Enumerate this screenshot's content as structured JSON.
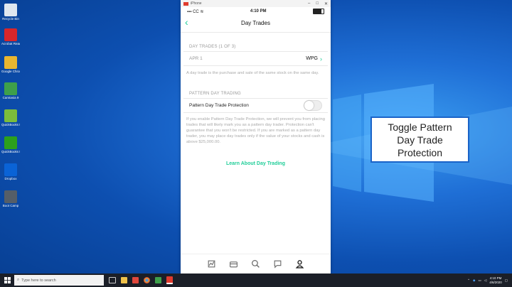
{
  "desktop": {
    "icons": [
      {
        "label": "Recycle Bin",
        "icon": "recycle-bin-icon",
        "color": "#dfe7ef"
      },
      {
        "label": "Acrobat Reader DC",
        "icon": "acrobat-icon",
        "color": "#d7262b"
      },
      {
        "label": "Google Chrome",
        "icon": "chrome-icon",
        "color": "#e9b630"
      },
      {
        "label": "Camtasia 9",
        "icon": "camtasia-icon",
        "color": "#3ea04b"
      },
      {
        "label": "QuickBooks File Manager",
        "icon": "quickbooks-file-icon",
        "color": "#7bbd3c"
      },
      {
        "label": "QuickBooks Premier",
        "icon": "quickbooks-icon",
        "color": "#2ca01c"
      },
      {
        "label": "Dropbox",
        "icon": "dropbox-icon",
        "color": "#0a63d6"
      },
      {
        "label": "Boot Camp",
        "icon": "drive-icon",
        "color": "#555e68"
      }
    ]
  },
  "window": {
    "title": "iPhone",
    "status": {
      "carrier": "CC",
      "time": "4:10 PM"
    },
    "nav": {
      "title": "Day Trades",
      "back_icon": "chevron-left-icon"
    },
    "day_trades": {
      "header": "DAY TRADES (1 OF 3)",
      "row_date": "APR 1",
      "row_symbol": "WPG",
      "definition": "A day trade is the purchase and sale of the same stock on the same day."
    },
    "pdt": {
      "header": "PATTERN DAY TRADING",
      "toggle_label": "Pattern Day Trade Protection",
      "toggle_on": false,
      "description": "If you enable Pattern Day Trade Protection, we will prevent you from placing trades that will likely mark you as a pattern day trader. Protection can't guarantee that you won't be restricted. If you are marked as a pattern day trader, you may place day trades only if the value of your stocks and cash is above $25,000.00."
    },
    "learn_link": "Learn About Day Trading",
    "tabs": [
      "portfolio-icon",
      "briefcase-icon",
      "search-icon",
      "chat-icon",
      "account-icon"
    ]
  },
  "callout": {
    "text": "Toggle Pattern Day Trade Protection"
  },
  "taskbar": {
    "search_placeholder": "Type here to search",
    "time": "4:10 PM",
    "date": "4/6/2020",
    "colors": {
      "accent": "#21ce99",
      "callout_border": "#1a63c8"
    }
  }
}
